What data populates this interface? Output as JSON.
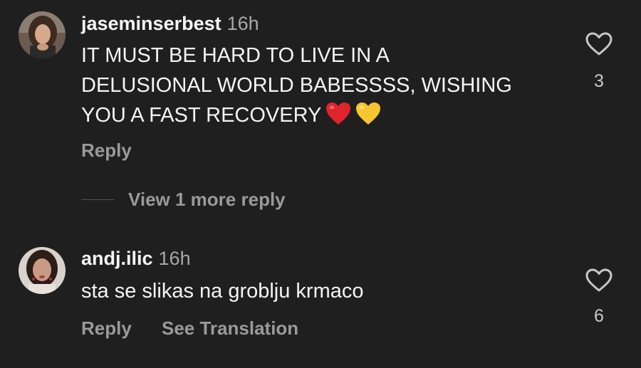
{
  "comments": [
    {
      "username": "jaseminserbest",
      "time": "16h",
      "text_lines": [
        "IT MUST BE HARD TO LIVE IN A",
        "DELUSIONAL WORLD BABESSSS, WISHING",
        "YOU A FAST RECOVERY"
      ],
      "emojis": [
        "red-heart",
        "yellow-heart"
      ],
      "reply_label": "Reply",
      "like_count": "3",
      "view_more_replies": "View 1 more reply"
    },
    {
      "username": "andj.ilic",
      "time": "16h",
      "text": "sta se slikas na groblju krmaco",
      "reply_label": "Reply",
      "translation_label": "See Translation",
      "like_count": "6"
    }
  ],
  "icons": {
    "like": "heart-outline-icon"
  },
  "colors": {
    "background": "#1f1f1f",
    "text": "#f5f5f5",
    "muted": "#a8a8a8",
    "action": "#9a9a9a"
  }
}
